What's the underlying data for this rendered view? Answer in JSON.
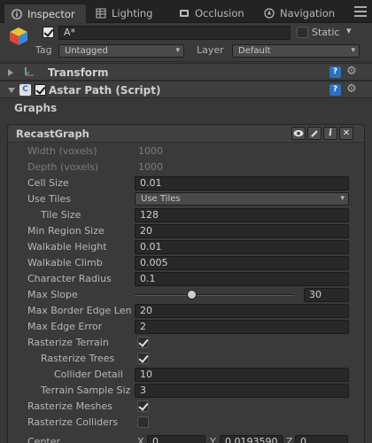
{
  "tabs": [
    {
      "label": "Inspector",
      "icon": "info-icon",
      "active": true
    },
    {
      "label": "Lighting",
      "icon": "lighting-icon",
      "active": false
    },
    {
      "label": "Occlusion",
      "icon": "occlusion-icon",
      "active": false
    },
    {
      "label": "Navigation",
      "icon": "navigation-icon",
      "active": false
    }
  ],
  "object": {
    "name": "A*",
    "active": true,
    "static_label": "Static",
    "static": false,
    "tag_label": "Tag",
    "tag_value": "Untagged",
    "layer_label": "Layer",
    "layer_value": "Default"
  },
  "components": {
    "transform_title": "Transform",
    "astar_title": "Astar Path (Script)"
  },
  "graphs_section": "Graphs",
  "graph": {
    "title": "RecastGraph",
    "buttons": [
      "eye-icon",
      "pencil-icon",
      "info-icon",
      "close-icon"
    ]
  },
  "fields": {
    "width_label": "Width (voxels)",
    "width_value": "1000",
    "depth_label": "Depth (voxels)",
    "depth_value": "1000",
    "cell_size_label": "Cell Size",
    "cell_size_value": "0.01",
    "use_tiles_label": "Use Tiles",
    "use_tiles_value": "Use Tiles",
    "tile_size_label": "Tile Size",
    "tile_size_value": "128",
    "min_region_label": "Min Region Size",
    "min_region_value": "20",
    "walkable_height_label": "Walkable Height",
    "walkable_height_value": "0.01",
    "walkable_climb_label": "Walkable Climb",
    "walkable_climb_value": "0.005",
    "char_radius_label": "Character Radius",
    "char_radius_value": "0.1",
    "max_slope_label": "Max Slope",
    "max_slope_value": "30",
    "max_border_label": "Max Border Edge Len",
    "max_border_value": "20",
    "max_edge_error_label": "Max Edge Error",
    "max_edge_error_value": "2",
    "rasterize_terrain_label": "Rasterize Terrain",
    "rasterize_trees_label": "Rasterize Trees",
    "collider_detail_label": "Collider Detail",
    "collider_detail_value": "10",
    "terrain_sample_label": "Terrain Sample Siz",
    "terrain_sample_value": "3",
    "rasterize_meshes_label": "Rasterize Meshes",
    "rasterize_colliders_label": "Rasterize Colliders",
    "center_label": "Center",
    "center_x_label": "X",
    "center_x": "0",
    "center_y_label": "Y",
    "center_y": "0.0193590",
    "center_z_label": "Z",
    "center_z": "0"
  },
  "colors": {
    "tab_bar": "#232323",
    "panel": "#383838",
    "field": "#282828",
    "help_blue": "#2f6fbf"
  }
}
